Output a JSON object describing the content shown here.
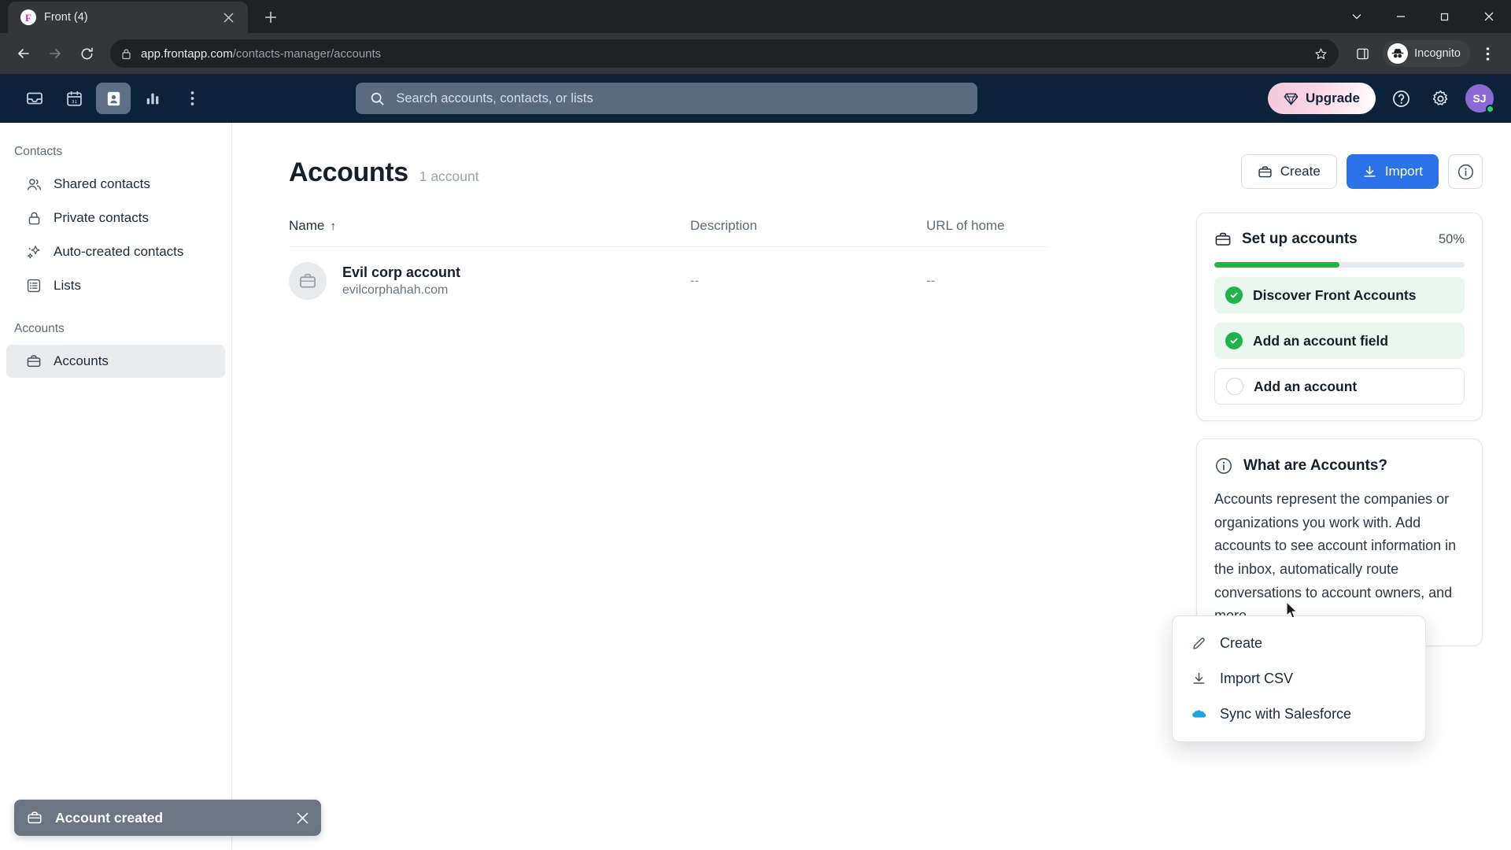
{
  "browser": {
    "tab": {
      "title": "Front (4)",
      "favicon_icon": "front-logo-icon",
      "close_icon": "close-icon"
    },
    "new_tab_icon": "plus-icon",
    "window_controls": {
      "chevron_icon": "chevron-down-icon",
      "minimize_icon": "minimize-icon",
      "maximize_icon": "maximize-icon",
      "close_icon": "close-icon"
    },
    "toolbar": {
      "back_icon": "back-arrow-icon",
      "forward_icon": "forward-arrow-icon",
      "reload_icon": "reload-icon",
      "lock_icon": "lock-icon",
      "url_domain": "app.frontapp.com",
      "url_path": "/contacts-manager/accounts",
      "bookmark_icon": "star-icon",
      "sidepanel_icon": "side-panel-icon",
      "incognito_label": "Incognito",
      "incognito_icon": "incognito-hat-icon",
      "menu_icon": "kebab-menu-icon"
    }
  },
  "app_header": {
    "nav": [
      {
        "name": "inbox",
        "icon": "inbox-icon",
        "active": false
      },
      {
        "name": "calendar",
        "icon": "calendar-31-icon",
        "active": false
      },
      {
        "name": "contacts",
        "icon": "contacts-person-icon",
        "active": true
      },
      {
        "name": "analytics",
        "icon": "bar-chart-icon",
        "active": false
      },
      {
        "name": "more",
        "icon": "kebab-menu-icon",
        "active": false
      }
    ],
    "search": {
      "placeholder": "Search accounts, contacts, or lists",
      "icon": "search-icon"
    },
    "upgrade": {
      "label": "Upgrade",
      "icon": "diamond-icon"
    },
    "help_icon": "help-circle-icon",
    "settings_icon": "gear-icon",
    "avatar_initials": "SJ"
  },
  "sidebar": {
    "sections": [
      {
        "title": "Contacts",
        "items": [
          {
            "label": "Shared contacts",
            "icon": "people-icon",
            "selected": false
          },
          {
            "label": "Private contacts",
            "icon": "lock-icon",
            "selected": false
          },
          {
            "label": "Auto-created contacts",
            "icon": "sparkles-icon",
            "selected": false
          },
          {
            "label": "Lists",
            "icon": "list-icon",
            "selected": false
          }
        ]
      },
      {
        "title": "Accounts",
        "items": [
          {
            "label": "Accounts",
            "icon": "briefcase-icon",
            "selected": true
          }
        ]
      }
    ]
  },
  "main": {
    "title": "Accounts",
    "count_label": "1 account",
    "table": {
      "columns": [
        {
          "key": "name",
          "label": "Name",
          "sort": "↑"
        },
        {
          "key": "description",
          "label": "Description",
          "sort": ""
        },
        {
          "key": "url",
          "label": "URL of home",
          "sort": ""
        }
      ],
      "rows": [
        {
          "name": "Evil corp account",
          "domain": "evilcorphahah.com",
          "description": "--",
          "url": "--",
          "avatar_icon": "briefcase-icon"
        }
      ]
    }
  },
  "right_rail": {
    "actions": {
      "create_label": "Create",
      "create_icon": "briefcase-plus-icon",
      "import_label": "Import",
      "import_icon": "download-icon",
      "info_icon": "info-circle-icon"
    },
    "setup_card": {
      "icon": "briefcase-icon",
      "title": "Set up accounts",
      "percent_label": "50%",
      "progress_percent": 50,
      "progress_color": "#22b24c",
      "tasks": [
        {
          "label": "Discover Front Accounts",
          "done": true
        },
        {
          "label": "Add an account field",
          "done": true
        },
        {
          "label": "Add an account",
          "done": false
        }
      ]
    },
    "info_card": {
      "icon": "info-circle-icon",
      "title": "What are Accounts?",
      "body": "Accounts represent the companies or organizations you work with. Add accounts to see account information in the inbox, automatically route conversations to account owners, and more."
    }
  },
  "dropdown": {
    "items": [
      {
        "label": "Create",
        "icon": "pencil-icon"
      },
      {
        "label": "Import CSV",
        "icon": "download-icon"
      },
      {
        "label": "Sync with Salesforce",
        "icon": "salesforce-cloud-icon"
      }
    ]
  },
  "toast": {
    "message": "Account created",
    "icon": "briefcase-icon",
    "close_icon": "close-icon",
    "background": "#6c7682"
  }
}
